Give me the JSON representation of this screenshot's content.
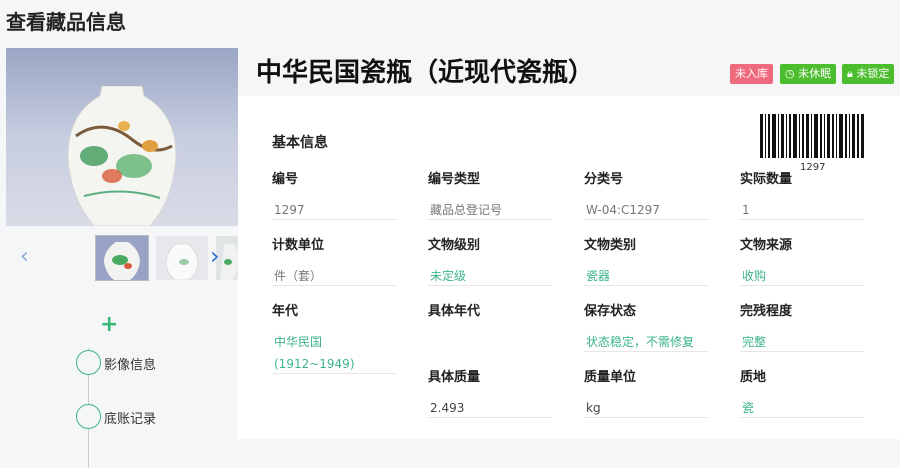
{
  "page": {
    "title": "查看藏品信息"
  },
  "item": {
    "title": "中华民国瓷瓶（近现代瓷瓶）",
    "badges": {
      "storage": "未入库",
      "dormant": "未休眠",
      "lock": "未锁定"
    },
    "barcode_number": "1297"
  },
  "gallery": {
    "prev_icon": "‹",
    "next_icon": "›"
  },
  "sidebar": {
    "add_icon": "+",
    "timeline": [
      {
        "label": "影像信息"
      },
      {
        "label": "底账记录"
      }
    ]
  },
  "basic_info": {
    "section_title": "基本信息",
    "fields": [
      {
        "label": "编号",
        "value": "1297"
      },
      {
        "label": "编号类型",
        "value": "藏品总登记号"
      },
      {
        "label": "分类号",
        "value": "W-04:C1297"
      },
      {
        "label": "实际数量",
        "value": "1"
      },
      {
        "label": "计数单位",
        "value": "件（套）"
      },
      {
        "label": "文物级别",
        "value": "未定级"
      },
      {
        "label": "文物类别",
        "value": "瓷器"
      },
      {
        "label": "文物来源",
        "value": "收购"
      },
      {
        "label": "年代",
        "value": "中华民国",
        "value2": "(1912~1949)"
      },
      {
        "label": "具体年代",
        "value": ""
      },
      {
        "label": "保存状态",
        "value": "状态稳定，不需修复"
      },
      {
        "label": "完残程度",
        "value": "完整"
      },
      {
        "label": "",
        "value": ""
      },
      {
        "label": "具体质量",
        "value": "2.493"
      },
      {
        "label": "质量单位",
        "value": "kg"
      },
      {
        "label": "质地",
        "value": "瓷"
      }
    ]
  },
  "colors": {
    "accent_green": "#3cb48a",
    "badge_red": "#ef6a7d",
    "badge_green": "#4cbd2d"
  }
}
